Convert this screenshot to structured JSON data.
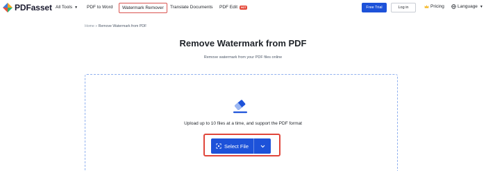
{
  "brand": {
    "name": "PDFasset"
  },
  "nav": {
    "all_tools": "All Tools",
    "pdf_to_word": "PDF to Word",
    "watermark_remover": "Watermark Remover",
    "translate_documents": "Translate Documents",
    "pdf_edit": "PDF Edit",
    "pdf_edit_badge": "HOT"
  },
  "header_actions": {
    "free_trial": "Free Trial",
    "login": "Log in",
    "pricing": "Pricing",
    "language": "Language"
  },
  "breadcrumb": {
    "home": "Home",
    "separator": " » ",
    "current": "Remove Watermark from PDF"
  },
  "main": {
    "title": "Remove Watermark from PDF",
    "subtitle": "Remove watermark from your PDF files online",
    "upload_hint": "Upload up to 10 files at a time, and support the PDF format",
    "select_file": "Select File"
  },
  "icons": {
    "logo": "pdfasset-logo-icon",
    "caret": "caret-down-icon",
    "pricing": "crown-icon",
    "language": "globe-icon",
    "upload": "eraser-icon",
    "select": "frame-icon",
    "dropdown": "chevron-down-icon"
  },
  "colors": {
    "primary": "#1d52d9",
    "highlight": "#e0453a",
    "dashed_border": "#8fb0ef"
  }
}
